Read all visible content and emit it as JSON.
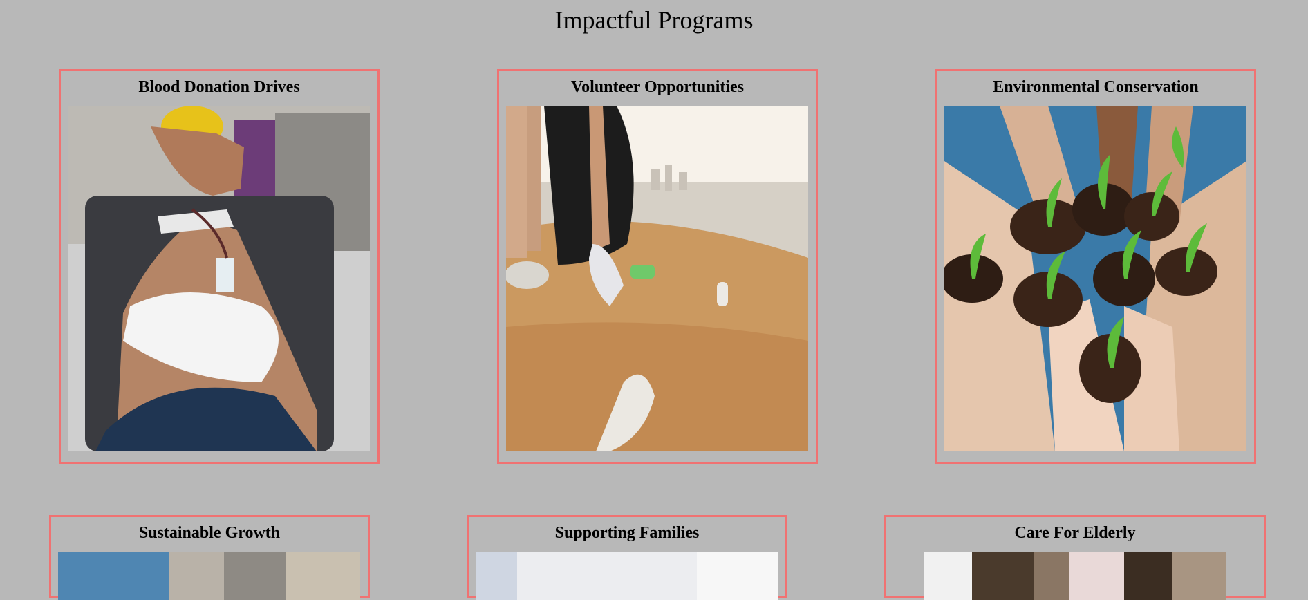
{
  "page": {
    "title": "Impactful Programs"
  },
  "programs": [
    {
      "title": "Blood Donation Drives",
      "image_icon": "blood-donation-photo"
    },
    {
      "title": "Volunteer Opportunities",
      "image_icon": "beach-cleanup-photo"
    },
    {
      "title": "Environmental Conservation",
      "image_icon": "seedlings-in-hands-photo"
    },
    {
      "title": "Sustainable Growth",
      "image_icon": "sustainable-growth-photo"
    },
    {
      "title": "Supporting Families",
      "image_icon": "supporting-families-photo"
    },
    {
      "title": "Care For Elderly",
      "image_icon": "elderly-care-photo"
    }
  ],
  "colors": {
    "background": "#b8b8b8",
    "card_border": "#f07272"
  }
}
